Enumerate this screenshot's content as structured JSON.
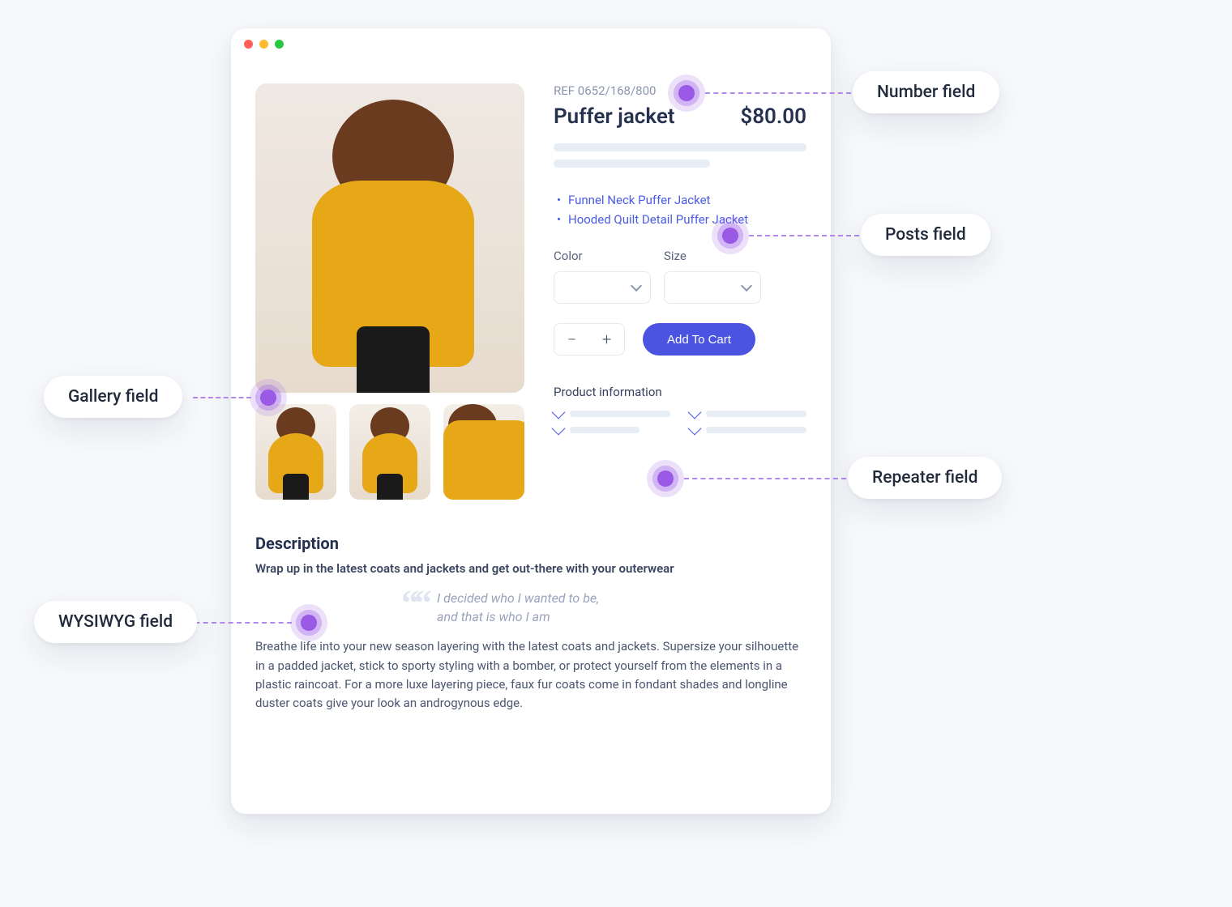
{
  "window": {
    "ref": "REF 0652/168/800",
    "name": "Puffer jacket",
    "price": "$80.00",
    "links": [
      "Funnel Neck Puffer Jacket",
      "Hooded Quilt Detail Puffer Jacket"
    ],
    "color_label": "Color",
    "size_label": "Size",
    "add_to_cart": "Add To Cart",
    "product_info_heading": "Product information",
    "desc_heading": "Description",
    "desc_lead": "Wrap up in the latest coats and jackets and get out-there with your outerwear",
    "quote_l1": "I decided who I wanted to be,",
    "quote_l2": "and that is who I am",
    "desc_body": "Breathe life into your new season layering with the latest coats and jackets. Supersize your silhouette in a padded jacket, stick to sporty styling with a bomber, or protect yourself from the elements in a plastic raincoat. For a more luxe layering piece, faux fur coats come in fondant shades and longline duster coats give your look an androgynous edge."
  },
  "annotations": {
    "number_field": "Number field",
    "posts_field": "Posts field",
    "repeater_field": "Repeater field",
    "gallery_field": "Gallery field",
    "wysiwyg_field": "WYSIWYG field"
  },
  "colors": {
    "accent_purple": "#9a5ae6",
    "primary_blue": "#4a54e1",
    "link_blue": "#4a5be6"
  }
}
